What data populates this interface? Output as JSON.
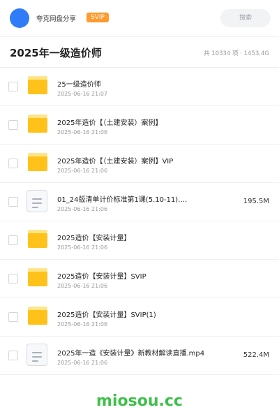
{
  "header": {
    "brand": "夸克网盘分享",
    "badge": "SVIP",
    "search_label": "搜索"
  },
  "page": {
    "title": "2025年一级造价师",
    "stats": "共 10334 项 · 1453.4G"
  },
  "files": [
    {
      "type": "folder",
      "name": "25一级造价师",
      "date": "2025-06-16 21:07",
      "size": ""
    },
    {
      "type": "folder",
      "name": "2025年造价【（土建安装）案例】",
      "date": "2025-06-16 21:06",
      "size": ""
    },
    {
      "type": "folder",
      "name": "2025年造价【（土建安装）案例】VIP",
      "date": "2025-06-16 21:06",
      "size": ""
    },
    {
      "type": "file",
      "name": "01_24版清单计价标准第1课(5.10-11).…",
      "date": "2025-06-16 21:06",
      "size": "195.5M"
    },
    {
      "type": "folder",
      "name": "2025造价【安装计量】",
      "date": "2025-06-16 21:06",
      "size": ""
    },
    {
      "type": "folder",
      "name": "2025造价【安装计量】SVIP",
      "date": "2025-06-16 21:06",
      "size": ""
    },
    {
      "type": "folder",
      "name": "2025造价【安装计量】SVIP(1)",
      "date": "2025-06-16 21:06",
      "size": ""
    },
    {
      "type": "file",
      "name": "2025年一造《安装计量》新教材解读直播.mp4",
      "date": "2025-06-16 21:06",
      "size": "522.4M"
    }
  ],
  "footer": {
    "watermark": "miosou.cc"
  }
}
